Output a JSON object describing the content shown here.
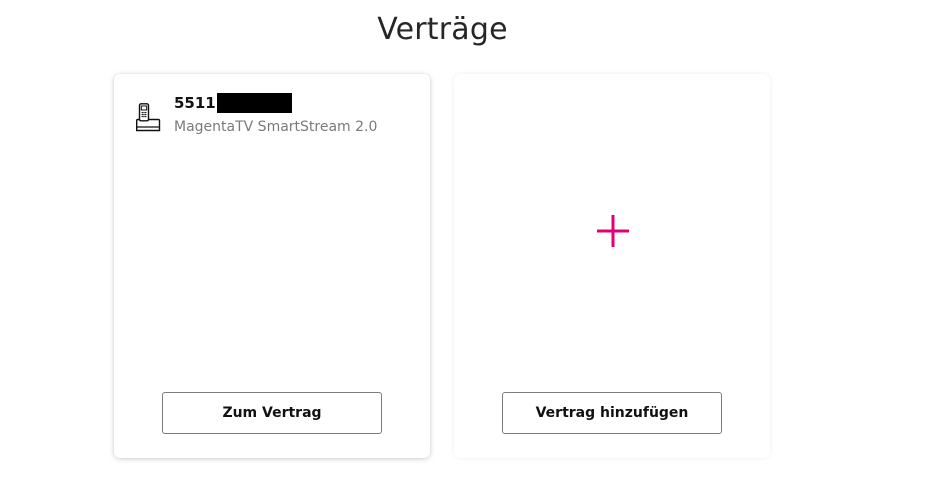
{
  "page": {
    "title": "Verträge"
  },
  "contract_card": {
    "number": "5511",
    "product": "MagentaTV SmartStream 2.0",
    "button_label": "Zum Vertrag",
    "icon": "phone-icon"
  },
  "add_card": {
    "icon": "plus-icon",
    "button_label": "Vertrag hinzufügen"
  },
  "colors": {
    "accent": "#e20074",
    "text": "#262626",
    "muted": "#7a7a7a",
    "border": "#7c7c7c"
  }
}
